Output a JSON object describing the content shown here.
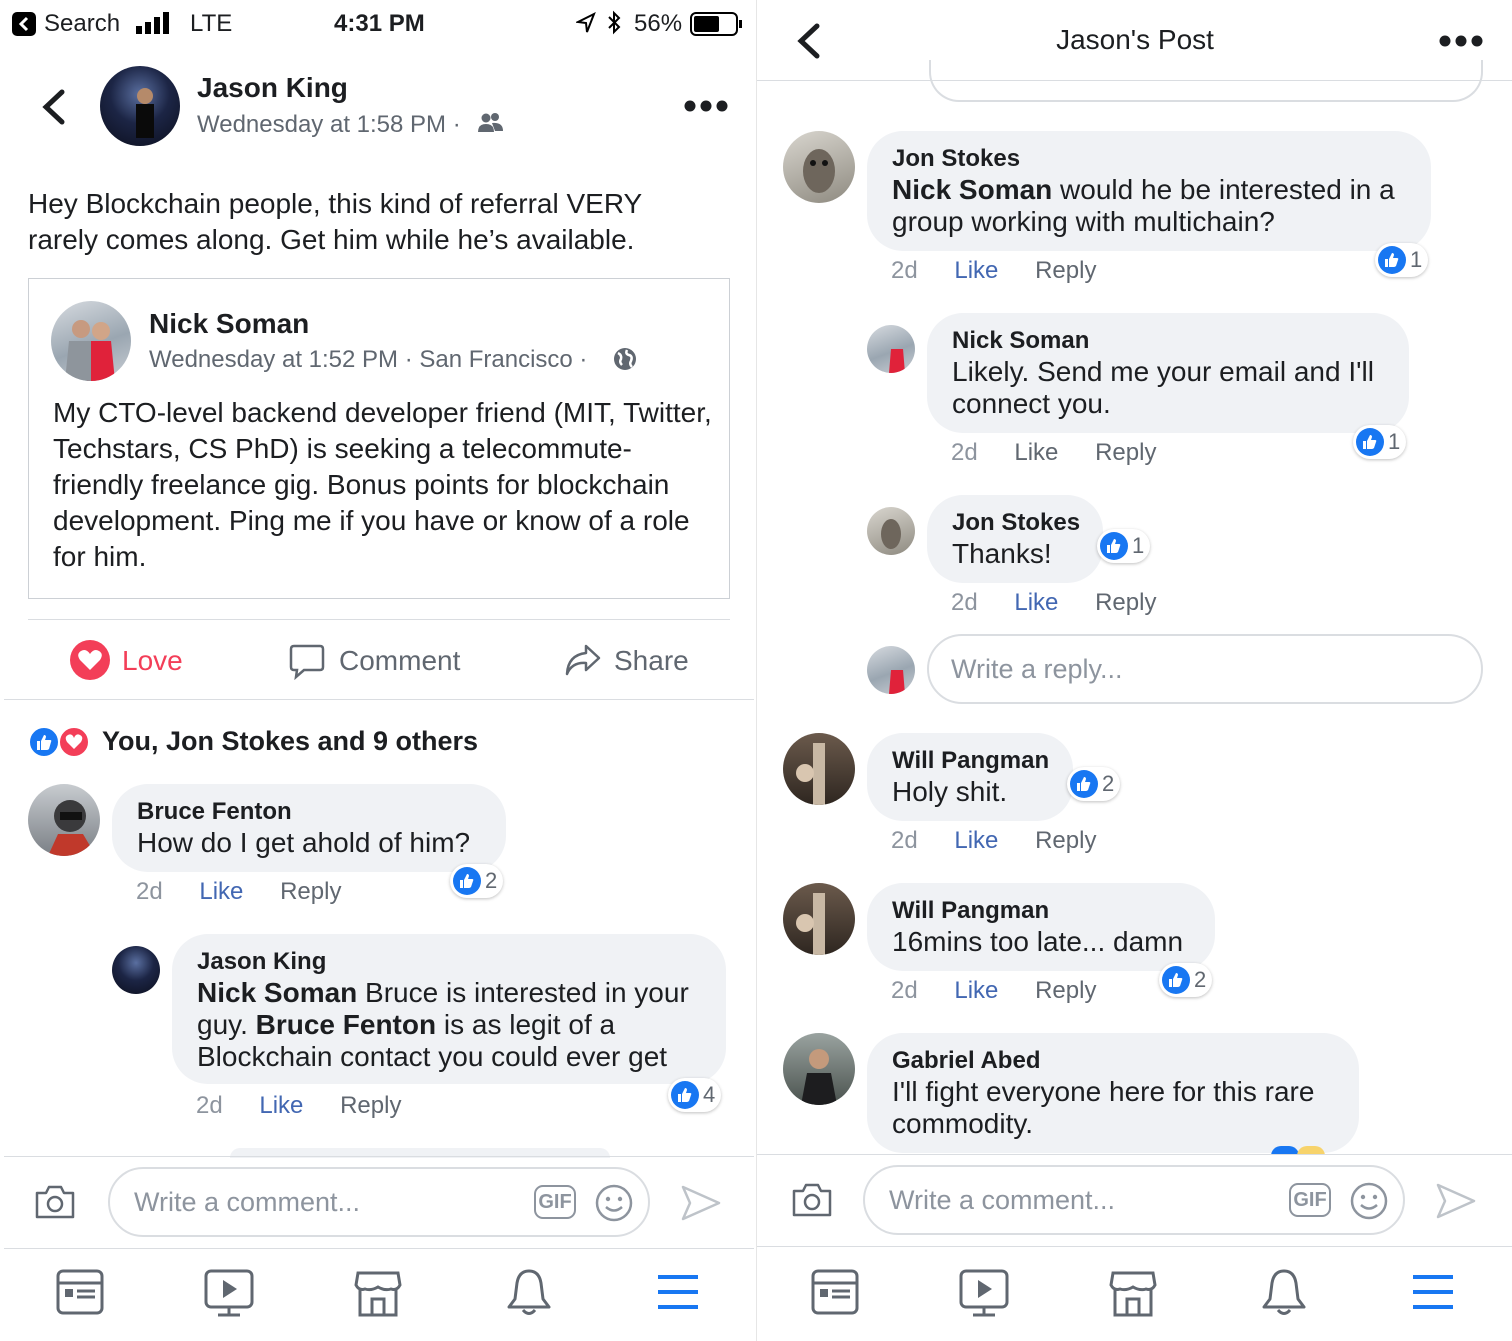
{
  "colors": {
    "accent": "#4267b2",
    "love": "#f33e58",
    "bubble": "#f0f2f5",
    "like_badge": "#1877f2"
  },
  "left": {
    "status": {
      "back_app": "Search",
      "carrier": "LTE",
      "time": "4:31 PM",
      "battery": "56%"
    },
    "header": {
      "author": "Jason King",
      "timestamp": "Wednesday at 1:58 PM ·",
      "audience_icon": "friends-icon"
    },
    "post_text": "Hey Blockchain people, this kind of referral VERY rarely comes along. Get him while he’s available.",
    "shared": {
      "author": "Nick Soman",
      "meta": "Wednesday at 1:52 PM · San Francisco ·",
      "text": "My CTO-level backend developer friend (MIT, Twitter, Techstars, CS PhD) is seeking a telecommute-friendly freelance gig. Bonus points for blockchain development. Ping me if you have or know of a role for him."
    },
    "actions": {
      "love": "Love",
      "comment": "Comment",
      "share": "Share"
    },
    "reactions_summary": "You, Jon Stokes and 9 others",
    "comments": [
      {
        "name": "Bruce Fenton",
        "text": "How do I get ahold of him?",
        "time": "2d",
        "like": "Like",
        "reply": "Reply",
        "count": "2"
      }
    ],
    "reply": {
      "name": "Jason King",
      "mention1": "Nick Soman",
      "text1": " Bruce is interested in your guy. ",
      "mention2": "Bruce Fenton",
      "text2": " is as legit of a Blockchain contact you could ever get",
      "time": "2d",
      "like": "Like",
      "reply": "Reply",
      "count": "4"
    },
    "composer": {
      "placeholder": "Write a comment...",
      "gif": "GIF"
    }
  },
  "right": {
    "title": "Jason's Post",
    "threads": [
      {
        "name": "Jon Stokes",
        "mention": "Nick Soman",
        "text": " would he be interested in a group working with multichain?",
        "time": "2d",
        "like": "Like",
        "reply": "Reply",
        "count": "1"
      },
      {
        "name": "Nick Soman",
        "text": "Likely. Send me your email and I'll connect you.",
        "time": "2d",
        "like": "Like",
        "reply": "Reply",
        "count": "1"
      },
      {
        "name": "Jon Stokes",
        "text": "Thanks!",
        "time": "2d",
        "like": "Like",
        "reply": "Reply",
        "count": "1"
      },
      {
        "name": "Will Pangman",
        "text": "Holy shit.",
        "time": "2d",
        "like": "Like",
        "reply": "Reply",
        "count": "2"
      },
      {
        "name": "Will Pangman",
        "text": "16mins too late... damn",
        "time": "2d",
        "like": "Like",
        "reply": "Reply",
        "count": "2"
      },
      {
        "name": "Gabriel Abed",
        "text": "I'll fight everyone here for this rare commodity."
      }
    ],
    "reply_placeholder": "Write a reply...",
    "composer": {
      "placeholder": "Write a comment...",
      "gif": "GIF"
    }
  },
  "tabbar": [
    "news-feed-icon",
    "watch-icon",
    "marketplace-icon",
    "notifications-icon",
    "menu-icon"
  ]
}
